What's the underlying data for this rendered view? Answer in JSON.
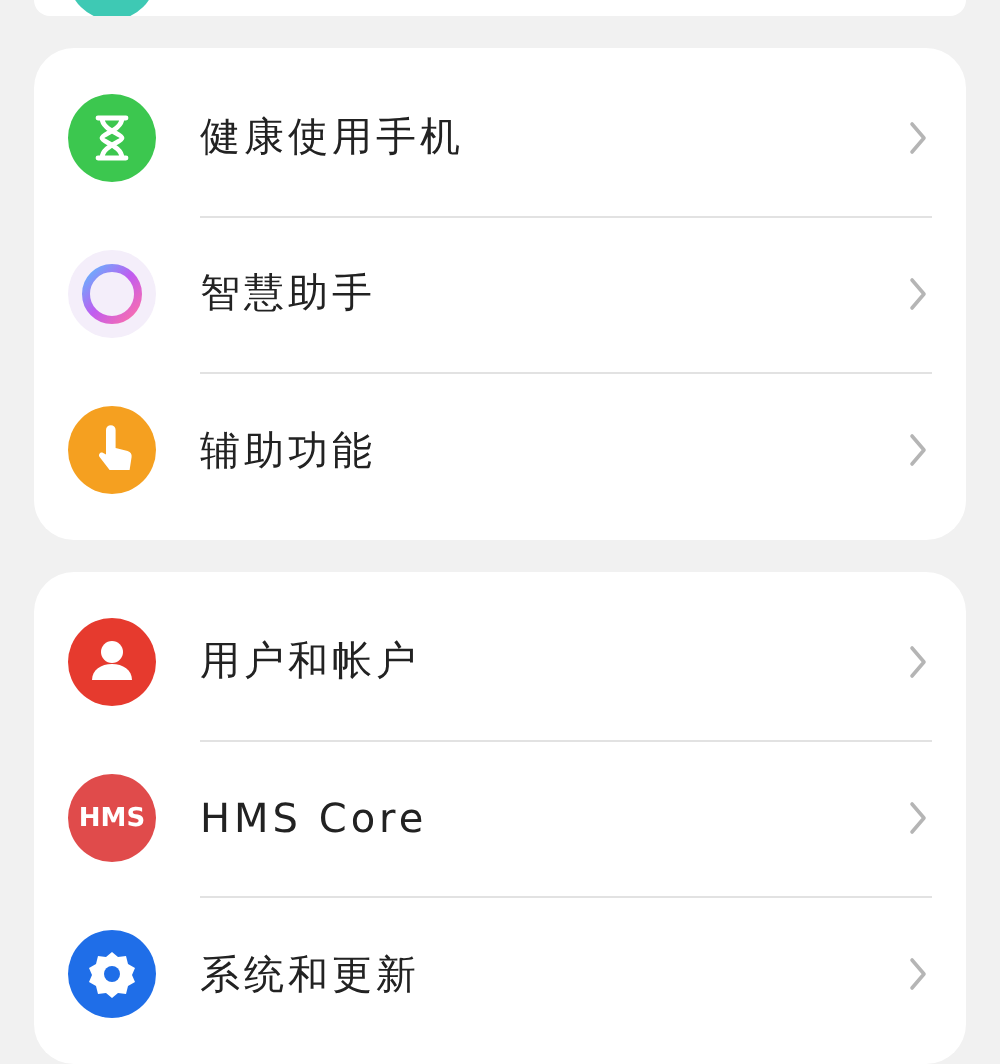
{
  "groups": [
    {
      "items": [
        {
          "kind": "hourglass",
          "label": "健康使用手机"
        },
        {
          "kind": "ring",
          "label": "智慧助手"
        },
        {
          "kind": "hand",
          "label": "辅助功能"
        }
      ]
    },
    {
      "items": [
        {
          "kind": "person",
          "label": "用户和帐户"
        },
        {
          "kind": "badge",
          "badge": "HMS",
          "label": "HMS Core"
        },
        {
          "kind": "gear",
          "label": "系统和更新"
        }
      ]
    }
  ]
}
